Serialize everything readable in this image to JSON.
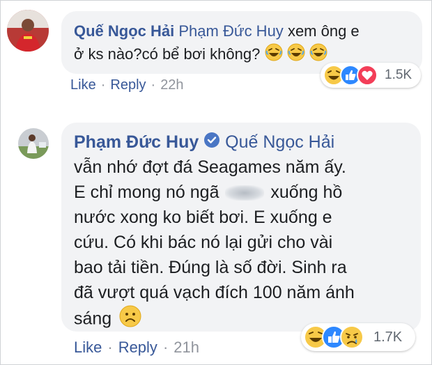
{
  "comment1": {
    "author": "Quế Ngọc Hải",
    "tag": "Phạm Đức Huy",
    "text_line1": "xem ông e",
    "text_line2": "ở ks nào?có bể bơi không?",
    "reaction_count": "1.5K",
    "actions": {
      "like": "Like",
      "reply": "Reply",
      "sep": "·",
      "time": "22h"
    },
    "icons": [
      "laughing-emoji-icon",
      "like-reaction-icon",
      "love-reaction-icon"
    ]
  },
  "comment2": {
    "author": "Phạm Đức Huy",
    "tag": "Quế Ngọc Hải",
    "lines": {
      "l1": "vẫn nhớ đợt đá Seagames năm ấy.",
      "l2a": "E chỉ mong nó ngã",
      "l2b": "xuống hồ",
      "l3": "nước xong ko biết bơi. E xuống e",
      "l4": "cứu. Có khi bác nó lại gửi cho vài",
      "l5": "bao tải tiền. Đúng là số đời. Sinh ra",
      "l6": "đã vượt quá vạch đích 100 năm ánh",
      "l7": "sáng"
    },
    "reaction_count": "1.7K",
    "actions": {
      "like": "Like",
      "reply": "Reply",
      "sep": "·",
      "time": "21h"
    },
    "icons": [
      "laughing-emoji-icon",
      "like-reaction-icon",
      "sad-reaction-icon"
    ]
  },
  "colors": {
    "name_blue": "#385898",
    "bubble_gray": "#f2f3f5",
    "meta_gray": "#90949c",
    "like_blue": "#2d88ff",
    "love_red": "#f33e58",
    "emoji_yellow": "#f7c948"
  }
}
